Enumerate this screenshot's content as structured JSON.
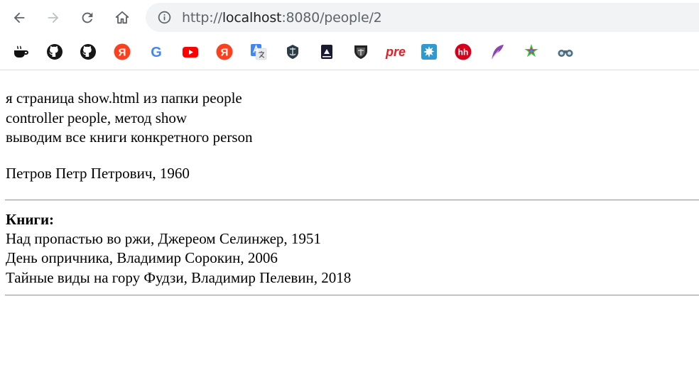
{
  "browser": {
    "url_prefix": "http://",
    "url_host": "localhost",
    "url_rest": ":8080/people/2",
    "bookmarks": [
      {
        "icon": "coffee-cup-icon"
      },
      {
        "icon": "github-icon"
      },
      {
        "icon": "github-icon"
      },
      {
        "icon": "yandex-icon",
        "text": "Я",
        "color": "#fc3f1d"
      },
      {
        "icon": "google-icon",
        "text": "G",
        "color": "#4285f4"
      },
      {
        "icon": "youtube-icon",
        "color": "#ff0000"
      },
      {
        "icon": "yandex-icon",
        "text": "Я",
        "color": "#fc3f1d"
      },
      {
        "icon": "google-translate-icon",
        "color": "#4285f4"
      },
      {
        "icon": "warships-icon"
      },
      {
        "icon": "book-icon"
      },
      {
        "icon": "tanks-shield-icon"
      },
      {
        "icon": "pre-icon",
        "text": "pre",
        "color": "#e31e24"
      },
      {
        "icon": "splash-icon",
        "color": "#2e9ad0"
      },
      {
        "icon": "hh-icon",
        "text": "hh",
        "color": "#d6001c"
      },
      {
        "icon": "feather-icon",
        "color": "#8e44ad"
      },
      {
        "icon": "stars-icon"
      },
      {
        "icon": "binoculars-icon"
      }
    ]
  },
  "page": {
    "intro_lines": [
      "я страница show.html из папки people",
      "controller people, метод show",
      "выводим все книги конкретного person"
    ],
    "person": "Петров Петр Петрович, 1960",
    "books_title": "Книги:",
    "books": [
      "Над пропастью во ржи, Джереом Селинжер, 1951",
      "День опричника, Владимир Сорокин, 2006",
      "Тайные виды на гору Фудзи, Владимир Пелевин, 2018"
    ]
  }
}
